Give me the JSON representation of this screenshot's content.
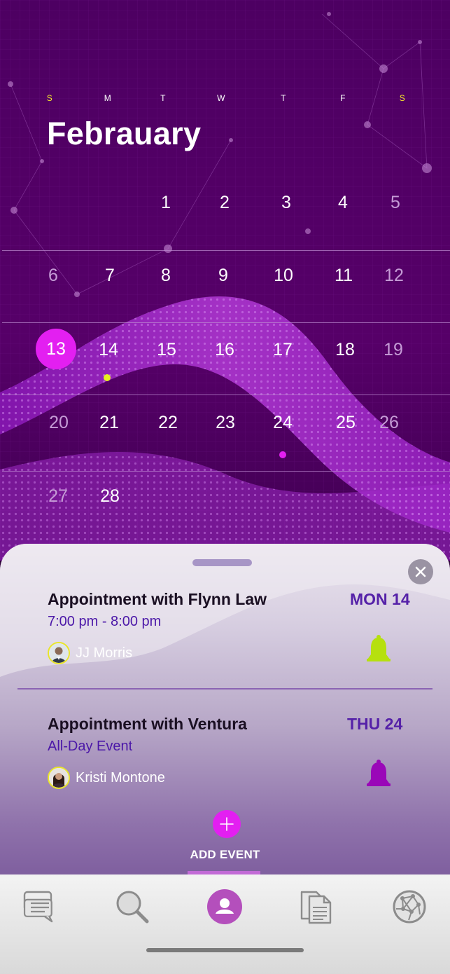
{
  "calendar": {
    "weekdays": [
      "S",
      "M",
      "T",
      "W",
      "T",
      "F",
      "S"
    ],
    "month": "Febrauary",
    "weeks": [
      [
        "",
        "",
        "1",
        "2",
        "3",
        "4",
        "5"
      ],
      [
        "6",
        "7",
        "8",
        "9",
        "10",
        "11",
        "12"
      ],
      [
        "13",
        "14",
        "15",
        "16",
        "17",
        "18",
        "19"
      ],
      [
        "20",
        "21",
        "22",
        "23",
        "24",
        "25",
        "26"
      ],
      [
        "27",
        "28",
        "",
        "",
        "",
        "",
        ""
      ]
    ],
    "selected_day": "13",
    "event_dots": [
      {
        "day": "14",
        "color": "#e6f01e"
      },
      {
        "day": "24",
        "color": "#e31ff1"
      }
    ]
  },
  "events": [
    {
      "title": "Appointment with Flynn Law",
      "time": "7:00 pm - 8:00 pm",
      "person": "JJ Morris",
      "date": "MON 14",
      "bell_icon": "bell-icon",
      "bell_color": "#b6e00e"
    },
    {
      "title": "Appointment with Ventura",
      "time": "All-Day Event",
      "person": "Kristi Montone",
      "date": "THU 24",
      "bell_icon": "bell-icon",
      "bell_color": "#9a07b8"
    }
  ],
  "add_event": {
    "label": "ADD EVENT"
  },
  "tabbar": {
    "items": [
      {
        "icon": "chat-icon"
      },
      {
        "icon": "search-icon"
      },
      {
        "icon": "profile-icon",
        "active": true
      },
      {
        "icon": "documents-icon"
      },
      {
        "icon": "globe-icon"
      }
    ]
  },
  "colors": {
    "accent": "#e31ff1",
    "weekend_header": "#f4e52a",
    "date_label": "#5521a8",
    "time_label": "#4b17a8"
  }
}
